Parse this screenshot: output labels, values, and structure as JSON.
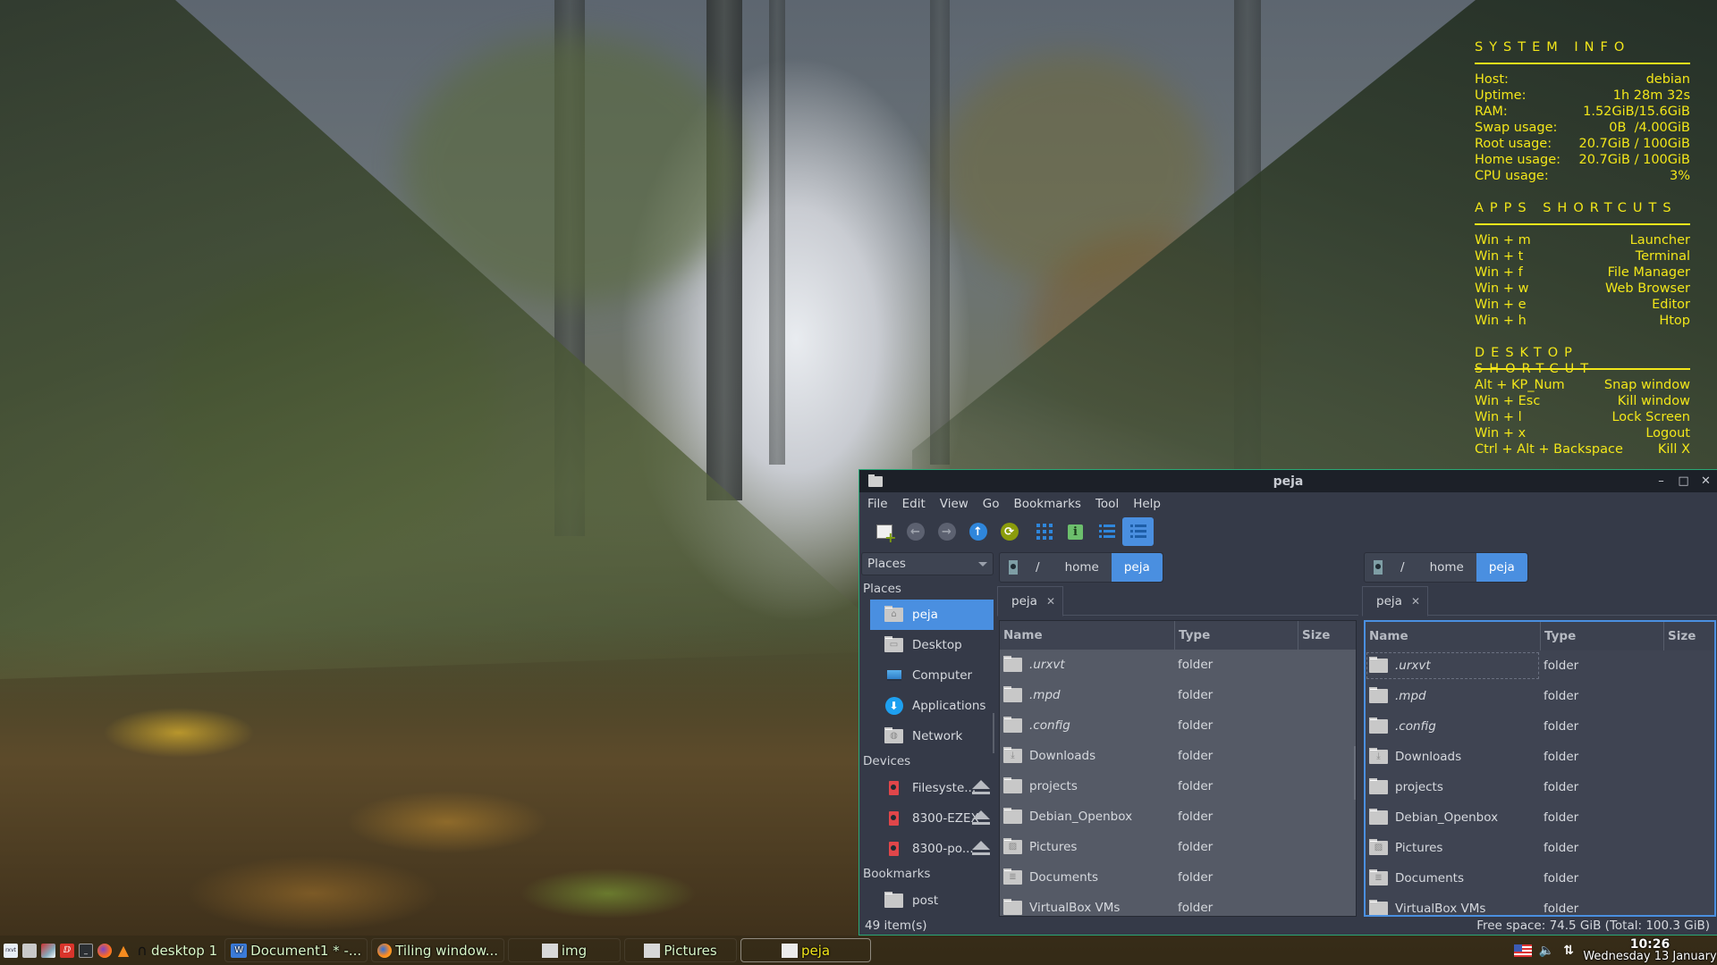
{
  "conky": {
    "sections": [
      {
        "title": "SYSTEM  INFO",
        "rows": [
          {
            "label": "Host:",
            "value": "debian"
          },
          {
            "label": "Uptime:",
            "value": "1h 28m 32s"
          },
          {
            "label": "RAM:",
            "value": "1.52GiB/15.6GiB"
          },
          {
            "label": "Swap usage:",
            "value": "0B  /4.00GiB"
          },
          {
            "label": "Root usage:",
            "value": "20.7GiB / 100GiB"
          },
          {
            "label": "Home usage:",
            "value": "20.7GiB / 100GiB"
          },
          {
            "label": "CPU usage:",
            "value": "3%"
          }
        ]
      },
      {
        "title": "APPS  SHORTCUTS",
        "rows": [
          {
            "label": "Win + m",
            "value": "Launcher"
          },
          {
            "label": "Win + t",
            "value": "Terminal"
          },
          {
            "label": "Win + f",
            "value": "File Manager"
          },
          {
            "label": "Win + w",
            "value": "Web Browser"
          },
          {
            "label": "Win + e",
            "value": "Editor"
          },
          {
            "label": "Win + h",
            "value": "Htop"
          }
        ]
      },
      {
        "title": "DESKTOP  SHORTCUT",
        "rows": [
          {
            "label": "Alt + KP_Num",
            "value": "Snap window"
          },
          {
            "label": "Win + Esc",
            "value": "Kill window"
          },
          {
            "label": "Win + l",
            "value": "Lock Screen"
          },
          {
            "label": "Win + x",
            "value": "Logout"
          },
          {
            "label": "Ctrl + Alt + Backspace",
            "value": "Kill X"
          }
        ]
      }
    ]
  },
  "window": {
    "title": "peja",
    "controls": {
      "minimize": "–",
      "maximize": "□",
      "close": "✕"
    },
    "menu": [
      "File",
      "Edit",
      "View",
      "Go",
      "Bookmarks",
      "Tool",
      "Help"
    ],
    "toolbar": [
      {
        "name": "new-window-icon"
      },
      {
        "name": "back-icon",
        "glyph": "←"
      },
      {
        "name": "forward-icon",
        "glyph": "→"
      },
      {
        "name": "up-icon",
        "glyph": "↑"
      },
      {
        "name": "reload-icon",
        "glyph": "⟳"
      },
      {
        "name": "icon-view-icon",
        "glyph": "⋮⋮⋮"
      },
      {
        "name": "info-icon",
        "glyph": "i"
      },
      {
        "name": "compact-view-icon",
        "glyph": "☰"
      },
      {
        "name": "detailed-view-icon",
        "glyph": "☰",
        "active": true
      }
    ],
    "sidebar": {
      "selector": "Places",
      "places_header": "Places",
      "places": [
        {
          "label": "peja",
          "icon": "home-folder-icon",
          "selected": true
        },
        {
          "label": "Desktop",
          "icon": "desktop-folder-icon"
        },
        {
          "label": "Computer",
          "icon": "computer-icon"
        },
        {
          "label": "Applications",
          "icon": "applications-icon"
        },
        {
          "label": "Network",
          "icon": "network-folder-icon"
        }
      ],
      "devices_header": "Devices",
      "devices": [
        {
          "label": "Filesyste...",
          "icon": "drive-icon"
        },
        {
          "label": "8300-EZEX",
          "icon": "drive-icon"
        },
        {
          "label": "8300-po...",
          "icon": "drive-icon"
        }
      ],
      "bookmarks_header": "Bookmarks",
      "bookmarks": [
        {
          "label": "post",
          "icon": "folder-icon"
        }
      ]
    },
    "panes": [
      {
        "path": [
          "/",
          "home",
          "peja"
        ],
        "tab": "peja",
        "columns": [
          "Name",
          "Type",
          "Size"
        ],
        "rows": [
          {
            "name": ".urxvt",
            "type": "folder",
            "hidden": true,
            "icon": "folder-icon"
          },
          {
            "name": ".mpd",
            "type": "folder",
            "hidden": true,
            "icon": "folder-icon"
          },
          {
            "name": ".config",
            "type": "folder",
            "hidden": true,
            "icon": "folder-icon"
          },
          {
            "name": "Downloads",
            "type": "folder",
            "icon": "downloads-folder-icon"
          },
          {
            "name": "projects",
            "type": "folder",
            "icon": "folder-icon"
          },
          {
            "name": "Debian_Openbox",
            "type": "folder",
            "icon": "folder-icon"
          },
          {
            "name": "Pictures",
            "type": "folder",
            "icon": "pictures-folder-icon"
          },
          {
            "name": "Documents",
            "type": "folder",
            "icon": "documents-folder-icon"
          },
          {
            "name": "VirtualBox VMs",
            "type": "folder",
            "icon": "folder-icon"
          }
        ]
      },
      {
        "path": [
          "/",
          "home",
          "peja"
        ],
        "tab": "peja",
        "columns": [
          "Name",
          "Type",
          "Size"
        ],
        "rows": [
          {
            "name": ".urxvt",
            "type": "folder",
            "hidden": true,
            "icon": "folder-icon"
          },
          {
            "name": ".mpd",
            "type": "folder",
            "hidden": true,
            "icon": "folder-icon"
          },
          {
            "name": ".config",
            "type": "folder",
            "hidden": true,
            "icon": "folder-icon"
          },
          {
            "name": "Downloads",
            "type": "folder",
            "icon": "downloads-folder-icon"
          },
          {
            "name": "projects",
            "type": "folder",
            "icon": "folder-icon"
          },
          {
            "name": "Debian_Openbox",
            "type": "folder",
            "icon": "folder-icon"
          },
          {
            "name": "Pictures",
            "type": "folder",
            "icon": "pictures-folder-icon"
          },
          {
            "name": "Documents",
            "type": "folder",
            "icon": "documents-folder-icon"
          },
          {
            "name": "VirtualBox VMs",
            "type": "folder",
            "icon": "folder-icon"
          }
        ]
      }
    ],
    "status": {
      "items": "49 item(s)",
      "free_space": "Free space: 74.5 GiB (Total: 100.3 GiB)"
    }
  },
  "taskbar": {
    "launchers": [
      {
        "name": "urxvt-launcher-icon"
      },
      {
        "name": "file-cabinet-launcher-icon"
      },
      {
        "name": "package-manager-launcher-icon"
      },
      {
        "name": "wps-launcher-icon"
      },
      {
        "name": "terminal-launcher-icon"
      },
      {
        "name": "firefox-launcher-icon"
      },
      {
        "name": "vlc-launcher-icon"
      },
      {
        "name": "headphones-launcher-icon"
      }
    ],
    "desktop_label": "desktop 1",
    "tasks": [
      {
        "label": "Document1 * -...",
        "icon": "writer-icon"
      },
      {
        "label": "Tiling window...",
        "icon": "firefox-icon"
      },
      {
        "label": "img",
        "icon": "folder-icon"
      },
      {
        "label": "Pictures",
        "icon": "folder-icon"
      },
      {
        "label": "peja",
        "icon": "folder-icon",
        "active": true
      }
    ],
    "clock": {
      "time": "10:26",
      "date": "Wednesday 13 January"
    }
  }
}
